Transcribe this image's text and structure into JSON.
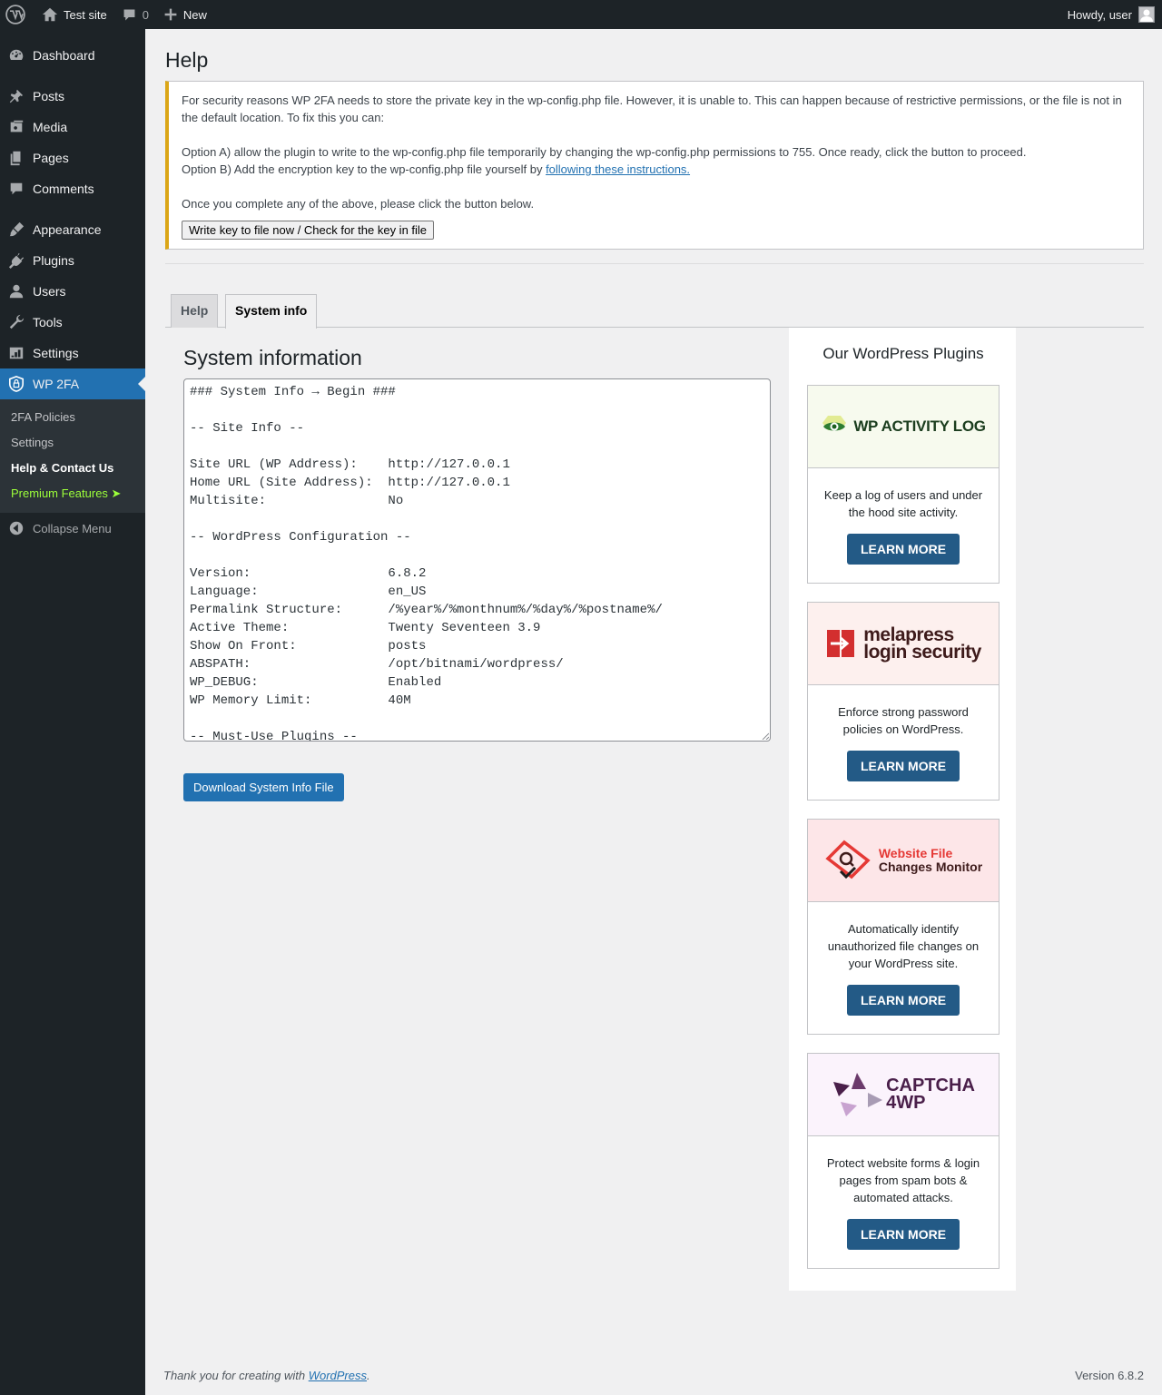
{
  "adminbar": {
    "site_name": "Test site",
    "comments_count": "0",
    "new_label": "New",
    "howdy": "Howdy, user"
  },
  "sidebar": {
    "items": [
      {
        "label": "Dashboard",
        "icon": "dashboard-icon"
      },
      {
        "label": "Posts",
        "icon": "pin-icon"
      },
      {
        "label": "Media",
        "icon": "media-icon"
      },
      {
        "label": "Pages",
        "icon": "pages-icon"
      },
      {
        "label": "Comments",
        "icon": "comment-icon"
      },
      {
        "label": "Appearance",
        "icon": "brush-icon"
      },
      {
        "label": "Plugins",
        "icon": "plug-icon"
      },
      {
        "label": "Users",
        "icon": "user-icon"
      },
      {
        "label": "Tools",
        "icon": "wrench-icon"
      },
      {
        "label": "Settings",
        "icon": "settings-icon"
      },
      {
        "label": "WP 2FA",
        "icon": "shield-icon"
      }
    ],
    "submenu": [
      "2FA Policies",
      "Settings",
      "Help & Contact Us",
      "Premium Features ➤"
    ],
    "collapse": "Collapse Menu"
  },
  "page": {
    "title": "Help"
  },
  "notice": {
    "line1": "For security reasons WP 2FA needs to store the private key in the wp-config.php file. However, it is unable to. This can happen because of restrictive permissions, or the file is not in the default location. To fix this you can:",
    "optionA": "Option A) allow the plugin to write to the wp-config.php file temporarily by changing the wp-config.php permissions to 755. Once ready, click the button to proceed.",
    "optionB_prefix": "Option B) Add the encryption key to the wp-config.php file yourself by ",
    "optionB_link": "following these instructions.",
    "complete": "Once you complete any of the above, please click the button below.",
    "button": "Write key to file now / Check for the key in file"
  },
  "tabs": [
    "Help",
    "System info"
  ],
  "sysinfo": {
    "heading": "System information",
    "text": "### System Info → Begin ###\n\n-- Site Info --\n\nSite URL (WP Address):    http://127.0.0.1\nHome URL (Site Address):  http://127.0.0.1\nMultisite:                No\n\n-- WordPress Configuration --\n\nVersion:                  6.8.2\nLanguage:                 en_US\nPermalink Structure:      /%year%/%monthnum%/%day%/%postname%/\nActive Theme:             Twenty Seventeen 3.9\nShow On Front:            posts\nABSPATH:                  /opt/bitnami/wordpress/\nWP_DEBUG:                 Enabled\nWP Memory Limit:          40M\n\n-- Must-Use Plugins --",
    "download_button": "Download System Info File"
  },
  "plugins": {
    "heading": "Our WordPress Plugins",
    "cards": [
      {
        "logo_name": "wp-activity-log-logo",
        "logo_text": "WP ACTIVITY LOG",
        "logo_bg": "#f7faee",
        "desc": "Keep a log of users and under the hood site activity.",
        "button": "LEARN MORE"
      },
      {
        "logo_name": "melapress-login-security-logo",
        "logo_text1": "melapress",
        "logo_text2": "login security",
        "logo_bg": "#fdf0ee",
        "desc": "Enforce strong password policies on WordPress.",
        "button": "LEARN MORE"
      },
      {
        "logo_name": "website-file-changes-monitor-logo",
        "logo_text1": "Website File",
        "logo_text2": "Changes Monitor",
        "logo_bg": "#fde6e8",
        "desc": "Automatically identify unauthorized file changes on your WordPress site.",
        "button": "LEARN MORE"
      },
      {
        "logo_name": "captcha-4wp-logo",
        "logo_text1": "CAPTCHA",
        "logo_text2": "4WP",
        "logo_bg": "#fbf3fc",
        "desc": "Protect website forms & login pages from spam bots & automated attacks.",
        "button": "LEARN MORE"
      }
    ]
  },
  "footer": {
    "thanks_prefix": "Thank you for creating with ",
    "thanks_link": "WordPress",
    "thanks_suffix": ".",
    "version": "Version 6.8.2"
  },
  "colors": {
    "accent": "#2271b1",
    "warning": "#dba617",
    "dark": "#1d2327",
    "learn_btn": "#235a86"
  }
}
